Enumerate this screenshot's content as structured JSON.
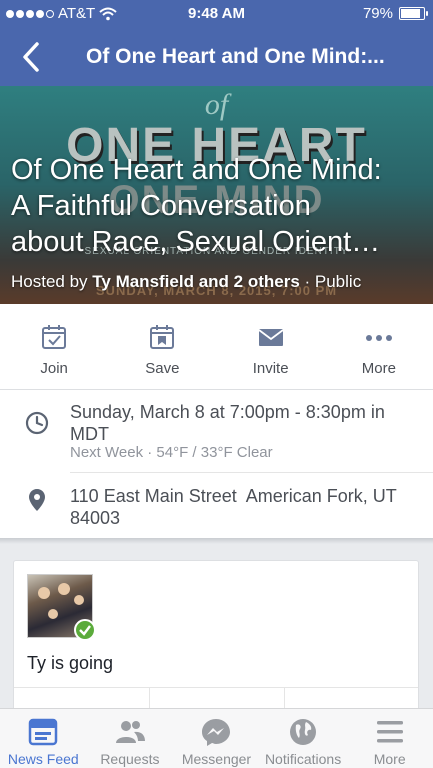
{
  "status_bar": {
    "carrier": "AT&T",
    "time": "9:48 AM",
    "battery": "79%",
    "battery_level": 0.79
  },
  "nav": {
    "title": "Of One Heart and One Mind:..."
  },
  "cover": {
    "art_of": "of",
    "art_line1": "ONE HEART",
    "art_line2": "ONE MIND",
    "art_small": "SEXUAL ORIENTATION AND GENDER IDENTITY",
    "art_date": "SUNDAY, MARCH 8, 2015, 7:00 PM",
    "title_line1": "Of One Heart and One Mind:",
    "title_line2": "A Faithful Conversation",
    "title_line3": "about Race, Sexual Orient…",
    "hosted_prefix": "Hosted by ",
    "hosted_by": "Ty Mansfield and 2 others",
    "privacy": " · Public"
  },
  "actions": [
    {
      "label": "Join",
      "icon": "calendar-check-icon"
    },
    {
      "label": "Save",
      "icon": "calendar-bookmark-icon"
    },
    {
      "label": "Invite",
      "icon": "envelope-icon"
    },
    {
      "label": "More",
      "icon": "more-dots-icon"
    }
  ],
  "details": {
    "time_text": "Sunday, March 8 at 7:00pm - 8:30pm in MDT",
    "weather": "Next Week · 54°F / 33°F Clear",
    "location": "110 East Main Street  American Fork, UT 84003"
  },
  "card": {
    "going_text": "Ty is going"
  },
  "tabbar": [
    {
      "label": "News Feed",
      "icon": "news-feed-icon",
      "active": true
    },
    {
      "label": "Requests",
      "icon": "friend-requests-icon",
      "active": false
    },
    {
      "label": "Messenger",
      "icon": "messenger-icon",
      "active": false
    },
    {
      "label": "Notifications",
      "icon": "globe-icon",
      "active": false
    },
    {
      "label": "More",
      "icon": "hamburger-menu-icon",
      "active": false
    }
  ],
  "colors": {
    "brand": "#4a67ad",
    "active_tab": "#4a76d1",
    "going_check": "#5bab3b"
  }
}
